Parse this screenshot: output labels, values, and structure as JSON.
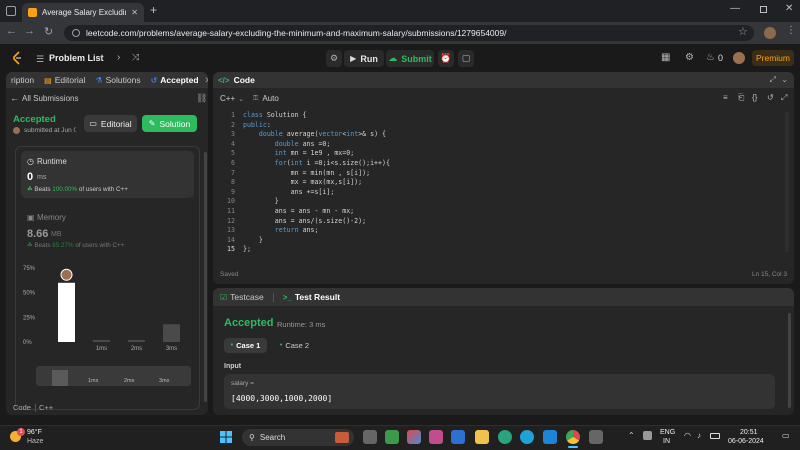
{
  "browser": {
    "tab_title": "Average Salary Excluding the M",
    "url": "leetcode.com/problems/average-salary-excluding-the-minimum-and-maximum-salary/submissions/1279654009/"
  },
  "header": {
    "problem_list": "Problem List",
    "run": "Run",
    "submit": "Submit",
    "streak_count": "0",
    "premium": "Premium"
  },
  "left": {
    "tabs": [
      "ription",
      "Editorial",
      "Solutions",
      "Accepted"
    ],
    "all_submissions": "All Submissions",
    "status": "Accepted",
    "submitted_at": "submitted at Jun 0",
    "editorial_btn": "Editorial",
    "solution_btn": "Solution",
    "runtime_label": "Runtime",
    "runtime_value": "0",
    "runtime_unit": "ms",
    "runtime_beats_prefix": "Beats",
    "runtime_beats_pct": "100.00%",
    "runtime_beats_suffix": "of users with C++",
    "memory_label": "Memory",
    "memory_value": "8.66",
    "memory_unit": "MB",
    "memory_beats_prefix": "Beats",
    "memory_beats_pct": "85.27%",
    "memory_beats_suffix": "of users with C++",
    "footer_code": "Code",
    "footer_lang": "C++"
  },
  "chart_data": {
    "type": "bar",
    "y_ticks": [
      "75%",
      "50%",
      "25%",
      "0%"
    ],
    "ylim": [
      0,
      75
    ],
    "categories": [
      "0ms",
      "1ms",
      "2ms",
      "3ms"
    ],
    "x_tick_labels": [
      "",
      "1ms",
      "2ms",
      "3ms"
    ],
    "values": [
      60,
      2,
      2,
      18
    ],
    "highlight_index": 0,
    "mini_tick_labels": [
      "1ms",
      "2ms",
      "3ms"
    ]
  },
  "code_panel": {
    "title": "Code",
    "language": "C++",
    "auto": "Auto",
    "saved": "Saved",
    "cursor": "Ln 15, Col 3",
    "lines": [
      "class Solution {",
      "public:",
      "    double average(vector<int>& s) {",
      "        double ans =0;",
      "        int mn = 1e9 , mx=0;",
      "        for(int i =0;i<s.size();i++){",
      "            mn = min(mn , s[i]);",
      "            mx = max(mx,s[i]);",
      "            ans +=s[i];",
      "        }",
      "        ans = ans - mn - mx;",
      "        ans = ans/(s.size()-2);",
      "        return ans;",
      "    }",
      "};"
    ]
  },
  "test_panel": {
    "testcase_tab": "Testcase",
    "result_tab": "Test Result",
    "status": "Accepted",
    "runtime": "Runtime: 3 ms",
    "case1": "Case 1",
    "case2": "Case 2",
    "input_label": "Input",
    "var_name": "salary =",
    "var_value": "[4000,3000,1000,2000]"
  },
  "taskbar": {
    "temp": "96°F",
    "weather": "Haze",
    "weather_badge": "1",
    "search": "Search",
    "lang1": "ENG",
    "lang2": "IN",
    "time": "20:51",
    "date": "06-06-2024"
  },
  "colors": {
    "accent_green": "#2cbb5d",
    "accepted_green": "#28c244",
    "bar_white": "#ffffff",
    "bar_gray": "#4a4a4a",
    "keyword_blue": "#569cd6",
    "premium_orange": "#ffa116"
  }
}
